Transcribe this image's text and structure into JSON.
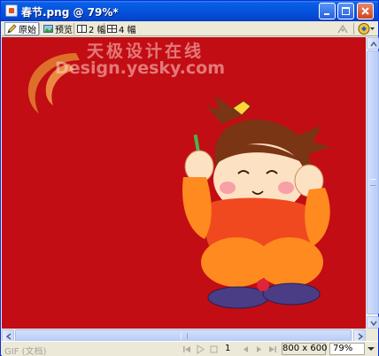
{
  "window": {
    "title": "春节.png @ 79%*"
  },
  "toolbar": {
    "tabs": [
      {
        "label": "原始",
        "icon": "pencil-icon",
        "selected": true
      },
      {
        "label": "预览",
        "icon": "preview-icon",
        "selected": false
      },
      {
        "label": "2 幅",
        "icon": "two-up-icon",
        "selected": false
      },
      {
        "label": "4 幅",
        "icon": "four-up-icon",
        "selected": false
      }
    ]
  },
  "canvas": {
    "background_color": "#c20d14",
    "watermark_cn": "天极设计在线",
    "watermark_en": "Design.yesky.com"
  },
  "statusbar": {
    "format": "GIF (文档)",
    "frame": "1",
    "size": "800 x 600",
    "zoom": "79%"
  }
}
